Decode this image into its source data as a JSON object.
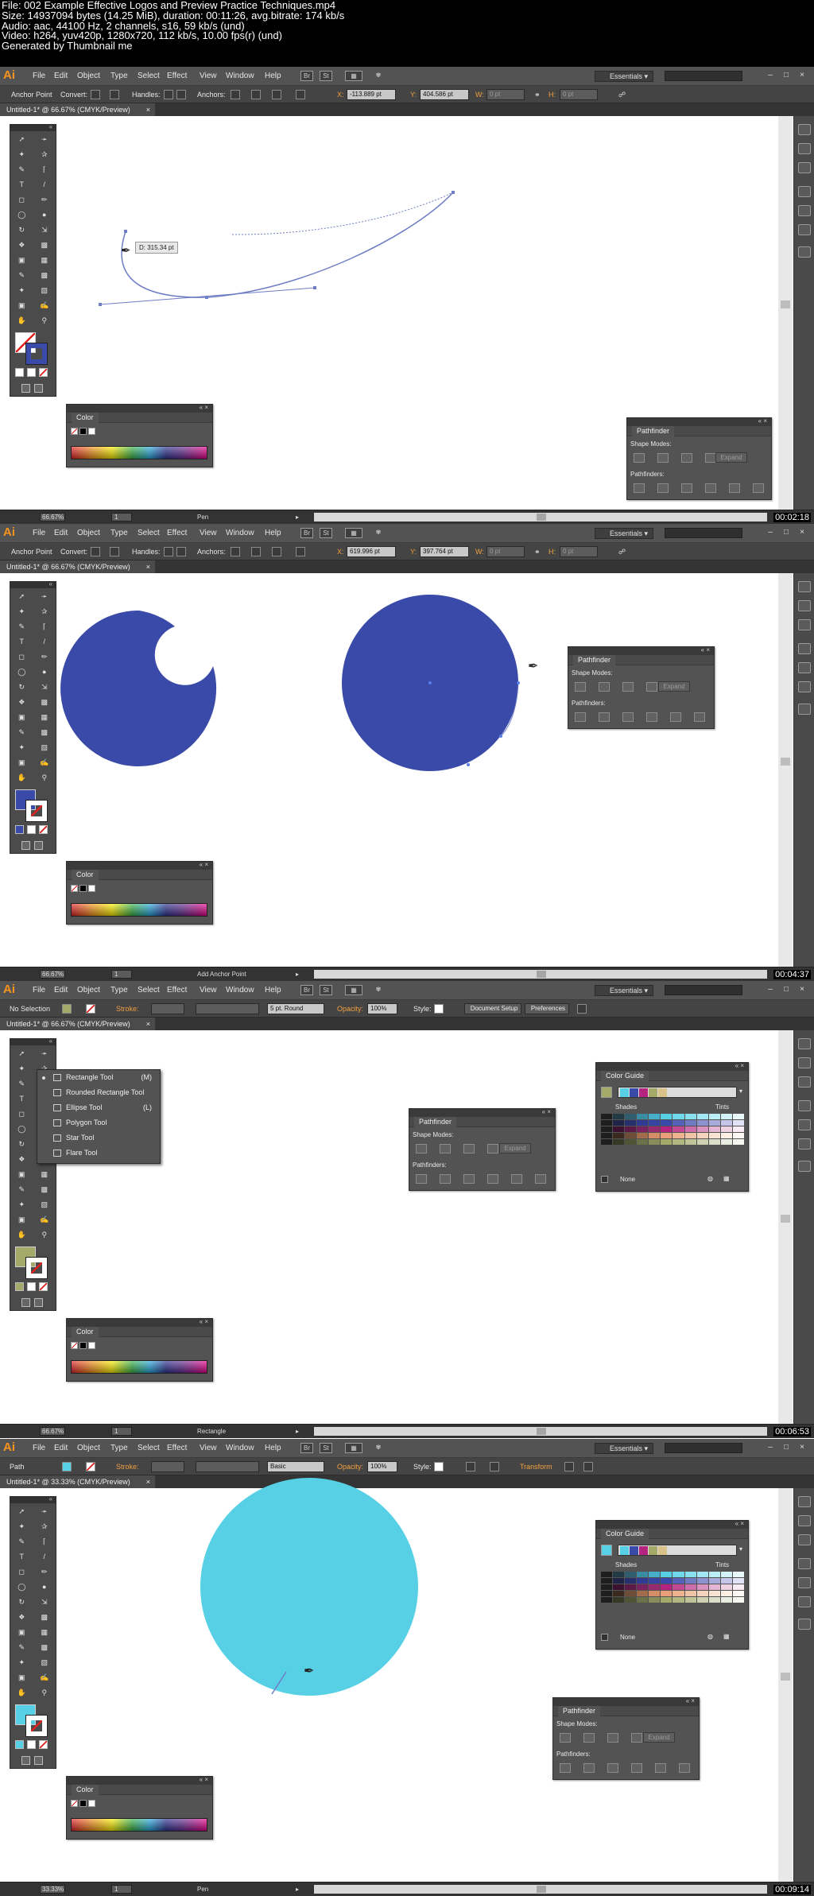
{
  "header": {
    "lines": [
      "File: 002 Example Effective Logos and Preview Practice Techniques.mp4",
      "Size: 14937094 bytes (14.25 MiB), duration: 00:11:26, avg.bitrate: 174 kb/s",
      "Audio: aac, 44100 Hz, 2 channels, s16, 59 kb/s (und)",
      "Video: h264, yuv420p, 1280x720, 112 kb/s, 10.00 fps(r) (und)",
      "Generated by Thumbnail me"
    ]
  },
  "menu": {
    "logo": "Ai",
    "items": [
      "File",
      "Edit",
      "Object",
      "Type",
      "Select",
      "Effect",
      "View",
      "Window",
      "Help"
    ],
    "icons": [
      "Br",
      "St"
    ],
    "workspace": "Essentials",
    "search_placeholder": ""
  },
  "frames": [
    {
      "timestamp": "00:02:18",
      "doc_tab": "Untitled-1* @ 66.67% (CMYK/Preview)",
      "control": {
        "mode_label": "Anchor Point",
        "convert_label": "Convert:",
        "handles_label": "Handles:",
        "anchors_label": "Anchors:",
        "x_label": "X:",
        "x_value": "-113.889 pt",
        "y_label": "Y:",
        "y_value": "404.586 pt",
        "w_label": "W:",
        "w_value": "0 pt",
        "h_label": "H:",
        "h_value": "0 pt"
      },
      "status": {
        "zoom": "66.67%",
        "page": "1",
        "tool": "Pen"
      },
      "tooltip": "D: 315.34 pt",
      "fill_color": "#ffffff",
      "stroke_color": "#3a4aa8",
      "pathfinder": {
        "title": "Pathfinder",
        "shape_modes": "Shape Modes:",
        "pathfinders": "Pathfinders:",
        "expand": "Expand"
      },
      "color_panel": {
        "title": "Color"
      }
    },
    {
      "timestamp": "00:04:37",
      "doc_tab": "Untitled-1* @ 66.67% (CMYK/Preview)",
      "control": {
        "mode_label": "Anchor Point",
        "convert_label": "Convert:",
        "handles_label": "Handles:",
        "anchors_label": "Anchors:",
        "x_label": "X:",
        "x_value": "619.996 pt",
        "y_label": "Y:",
        "y_value": "397.764 pt",
        "w_label": "W:",
        "w_value": "0 pt",
        "h_label": "H:",
        "h_value": "0 pt"
      },
      "status": {
        "zoom": "66.67%",
        "page": "1",
        "tool": "Add Anchor Point"
      },
      "fill_color": "#3a4aa8",
      "stroke_color": "#ffffff",
      "pathfinder": {
        "title": "Pathfinder",
        "shape_modes": "Shape Modes:",
        "pathfinders": "Pathfinders:",
        "expand": "Expand"
      },
      "color_panel": {
        "title": "Color"
      }
    },
    {
      "timestamp": "00:06:53",
      "doc_tab": "Untitled-1* @ 66.67% (CMYK/Preview)",
      "control": {
        "selection_label": "No Selection",
        "stroke_label": "Stroke:",
        "brush_value": "5 pt. Round",
        "opacity_label": "Opacity:",
        "opacity_value": "100%",
        "style_label": "Style:",
        "doc_setup": "Document Setup",
        "preferences": "Preferences"
      },
      "status": {
        "zoom": "66.67%",
        "page": "1",
        "tool": "Rectangle"
      },
      "fill_color": "#a3aa6a",
      "stroke_color": "#ffffff",
      "flyout": [
        {
          "label": "Rectangle Tool",
          "key": "(M)"
        },
        {
          "label": "Rounded Rectangle Tool",
          "key": ""
        },
        {
          "label": "Ellipse Tool",
          "key": "(L)"
        },
        {
          "label": "Polygon Tool",
          "key": ""
        },
        {
          "label": "Star Tool",
          "key": ""
        },
        {
          "label": "Flare Tool",
          "key": ""
        }
      ],
      "pathfinder": {
        "title": "Pathfinder",
        "shape_modes": "Shape Modes:",
        "pathfinders": "Pathfinders:",
        "expand": "Expand"
      },
      "color_guide": {
        "title": "Color Guide",
        "shades": "Shades",
        "tints": "Tints",
        "none_label": "None"
      },
      "color_panel": {
        "title": "Color"
      }
    },
    {
      "timestamp": "00:09:14",
      "doc_tab": "Untitled-1* @ 33.33% (CMYK/Preview)",
      "control": {
        "selection_label": "Path",
        "stroke_label": "Stroke:",
        "brush_value": "Basic",
        "opacity_label": "Opacity:",
        "opacity_value": "100%",
        "style_label": "Style:",
        "transform": "Transform"
      },
      "status": {
        "zoom": "33.33%",
        "page": "1",
        "tool": "Pen"
      },
      "fill_color": "#57d0e6",
      "stroke_color": "#ffffff",
      "pathfinder": {
        "title": "Pathfinder",
        "shape_modes": "Shape Modes:",
        "pathfinders": "Pathfinders:",
        "expand": "Expand"
      },
      "color_guide": {
        "title": "Color Guide",
        "shades": "Shades",
        "tints": "Tints",
        "none_label": "None"
      },
      "color_panel": {
        "title": "Color"
      }
    }
  ],
  "colors": {
    "shape_blue": "#3a4aa8",
    "shape_cyan": "#57d0e6",
    "path_line": "#6f7dc4",
    "ui_dark": "#535353",
    "accent_orange": "#f7941d"
  }
}
